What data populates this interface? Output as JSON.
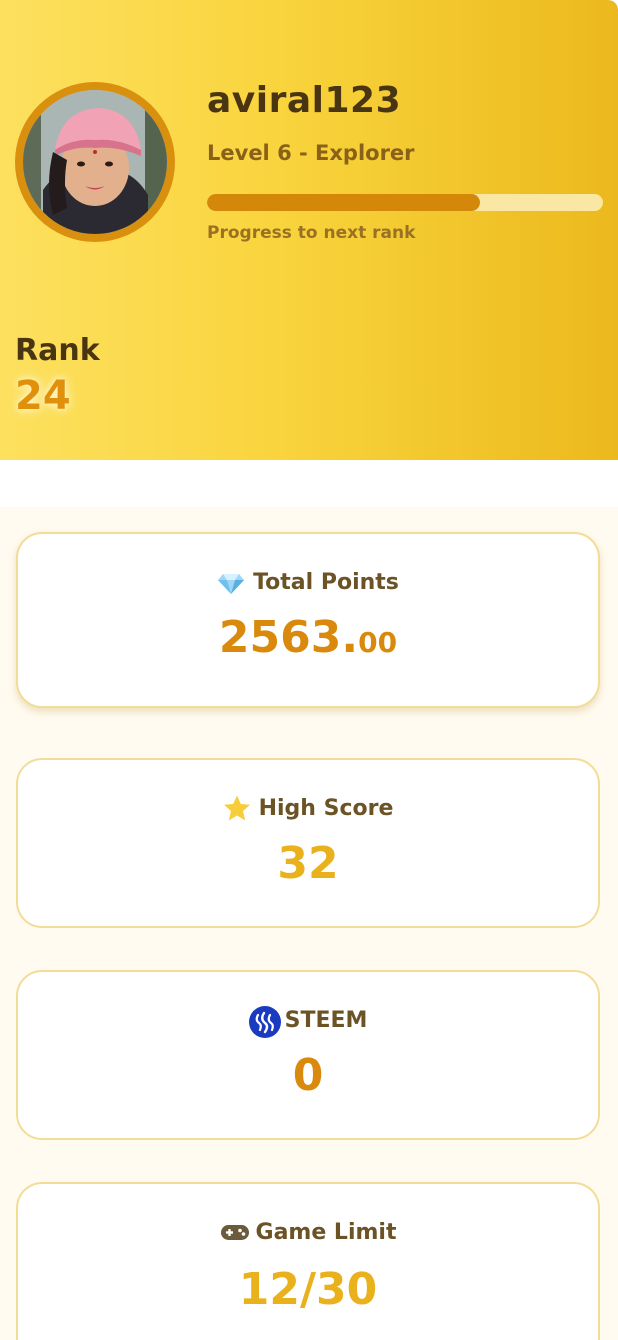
{
  "profile": {
    "username": "aviral123",
    "level": "Level 6 - Explorer",
    "progress_label": "Progress to next rank",
    "progress_fraction": 0.69,
    "rank_label": "Rank",
    "rank_value": "24"
  },
  "stats": {
    "total_points": {
      "label": "Total Points",
      "value_int": "2563.",
      "value_dec": "00",
      "icon": "diamond-icon"
    },
    "high_score": {
      "label": "High Score",
      "value": "32",
      "icon": "star-icon"
    },
    "steem": {
      "label": "STEEM",
      "value": "0",
      "icon": "steem-logo-icon"
    },
    "game_limit": {
      "label": "Game Limit",
      "value": "12/30",
      "icon": "gamepad-icon"
    }
  },
  "colors": {
    "header_start": "#fde05f",
    "header_end": "#ebb91d",
    "accent_orange": "#d98a0c",
    "accent_yellow": "#e9b21c",
    "progress_fill": "#d4880a",
    "progress_track": "#fbe7a4",
    "card_border": "#f3dc98"
  }
}
